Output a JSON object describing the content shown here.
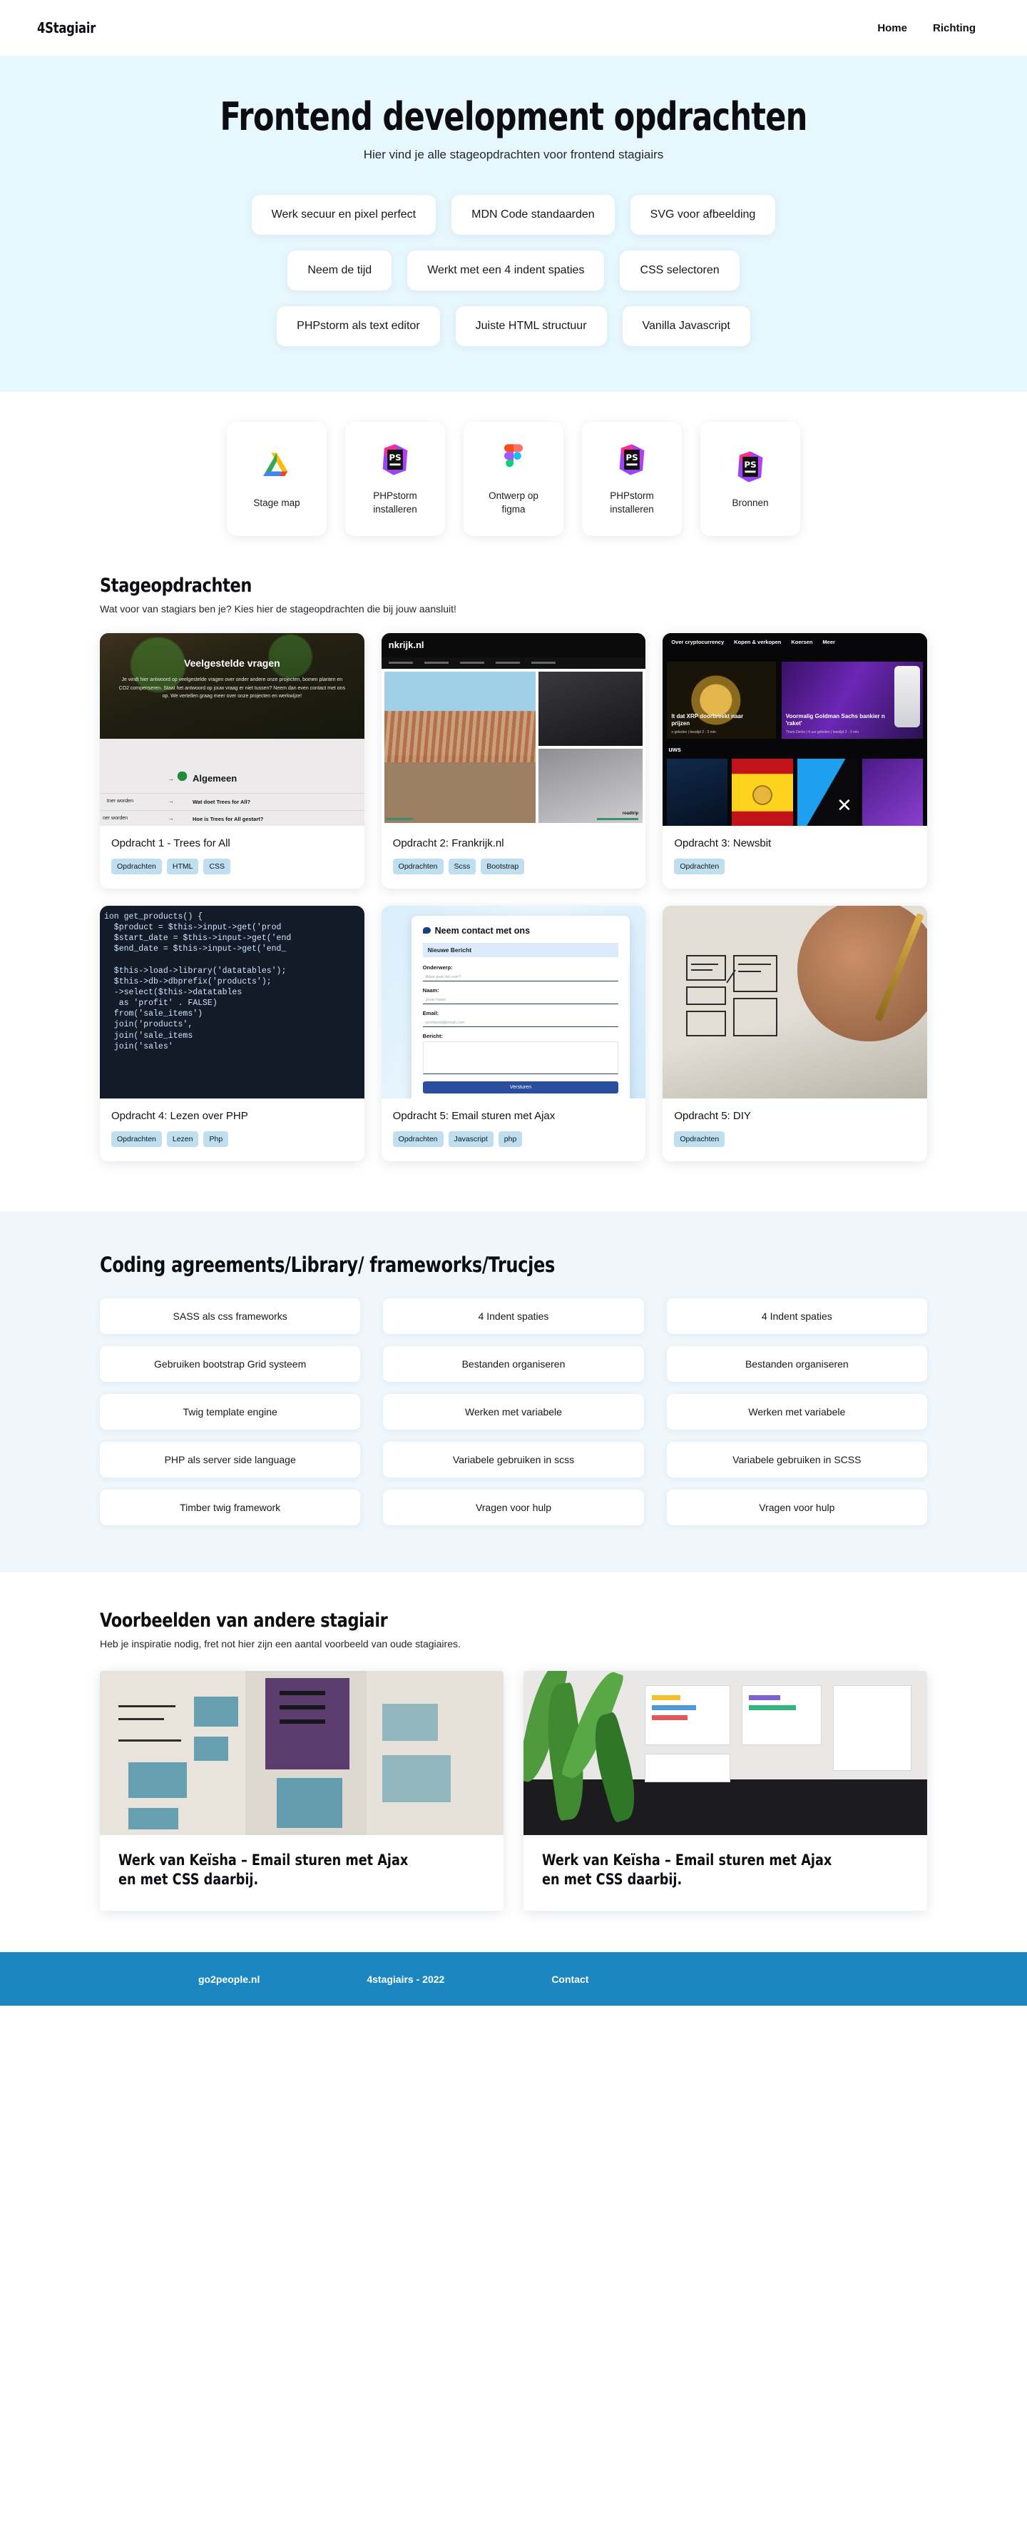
{
  "header": {
    "brand": "4Stagiair",
    "nav": [
      {
        "label": "Home"
      },
      {
        "label": "Richting"
      }
    ]
  },
  "hero": {
    "title": "Frontend development opdrachten",
    "subtitle": "Hier vind je alle stageopdrachten voor frontend stagiairs",
    "pill_rows": [
      [
        "Werk secuur en pixel perfect",
        "MDN Code standaarden",
        "SVG voor afbeelding"
      ],
      [
        "Neem de tijd",
        "Werkt met een 4 indent spaties",
        "CSS selectoren"
      ],
      [
        "PHPstorm als text editor",
        "Juiste HTML structuur",
        "Vanilla Javascript"
      ]
    ],
    "background": "#e6f7fd"
  },
  "tools": [
    {
      "icon": "google-drive-icon",
      "label": "Stage map"
    },
    {
      "icon": "phpstorm-icon",
      "label": "PHPstorm installeren"
    },
    {
      "icon": "figma-icon",
      "label": "Ontwerp op figma"
    },
    {
      "icon": "phpstorm-icon",
      "label": "PHPstorm installeren"
    },
    {
      "icon": "phpstorm-icon",
      "label": "Bronnen"
    }
  ],
  "opdrachten": {
    "title": "Stageopdrachten",
    "subtitle": "Wat voor van stagiars ben je? Kies hier de stageopdrachten die bij jouw aansluit!",
    "cards": [
      {
        "title": "Opdracht 1 - Trees for All",
        "tags": [
          "Opdrachten",
          "HTML",
          "CSS"
        ],
        "thumb": "trees-for-all-faq-screenshot",
        "thumb_text": {
          "heading": "Veelgestelde vragen",
          "paragraph": "Je vindt hier antwoord op veelgestelde vragen over onder andere onze projecten, bomen planten en CO2 compenseren. Staat het antwoord op jouw vraag er niet tussen? Neem dan even contact met ons op. We vertellen graag meer over onze projecten en werkwijze!",
          "category": "Algemeen",
          "q1": "Wat doet Trees for All?",
          "q2": "Hoe is Trees for All gestart?",
          "side1": "tner worden",
          "side2": "ner worden"
        }
      },
      {
        "title": "Opdracht 2: Frankrijk.nl",
        "tags": [
          "Opdrachten",
          "Scss",
          "Bootstrap"
        ],
        "thumb": "frankrijk-nl-screenshot",
        "thumb_text": {
          "brand": "nkrijk.nl",
          "caption": "roadtrip"
        }
      },
      {
        "title": "Opdracht 3: Newsbit",
        "tags": [
          "Opdrachten"
        ],
        "thumb": "newsbit-crypto-screenshot",
        "thumb_text": {
          "nav": [
            "Over cryptocurrency",
            "Kopen & verkopen",
            "Koersen",
            "Meer"
          ],
          "feature1": "lt dat XRP doorbreekt naar prijzen",
          "feature2": "Voormalig Goldman Sachs bankier n 'raket'",
          "meta1": "o geleden  |  leestijd 2 - 3 min",
          "meta2": "Thom Derks  |  4 uur geleden  |  leestijd 2 - 3 min",
          "section": "uws"
        }
      },
      {
        "title": "Opdracht 4: Lezen over PHP",
        "tags": [
          "Opdrachten",
          "Lezen",
          "Php"
        ],
        "thumb": "php-code-screenshot",
        "code": "ion get_products() {\n  $product = $this->input->get('prod\n  $start_date = $this->input->get('end\n  $end_date = $this->input->get('end_\n\n  $this->load->library('datatables');\n  $this->db->dbprefix('products');\n  ->select($this->datatables\n   as 'profit' . FALSE)\n  from('sale_items')\n  join('products',\n  join('sale_items\n  join('sales'"
      },
      {
        "title": "Opdracht 5: Email sturen met Ajax",
        "tags": [
          "Opdrachten",
          "Javascript",
          "php"
        ],
        "thumb": "contact-form-screenshot",
        "thumb_text": {
          "heading": "Neem contact met ons",
          "badge": "Nieuwe Bericht",
          "label1": "Onderwerp:",
          "ph1": "Waar gaat het over?",
          "label2": "Naam:",
          "ph2": "Jouw naam",
          "label3": "Email:",
          "ph3": "voorbeeld@email.com",
          "label4": "Bericht:",
          "button": "Versturen"
        }
      },
      {
        "title": "Opdracht 5: DIY",
        "tags": [
          "Opdrachten"
        ],
        "thumb": "hand-drawing-wireframe-photo"
      }
    ]
  },
  "coding": {
    "title": "Coding agreements/Library/ frameworks/Trucjes",
    "columns": [
      [
        "SASS als css frameworks",
        "Gebruiken bootstrap Grid systeem",
        "Twig template engine",
        "PHP als server side language",
        "Timber twig framework"
      ],
      [
        "4 Indent spaties",
        "Bestanden organiseren",
        "Werken met variabele",
        "Variabele gebruiken in scss",
        "Vragen voor hulp"
      ],
      [
        "4 Indent spaties",
        "Bestanden organiseren",
        "Werken met variabele",
        "Variabele gebruiken in SCSS",
        "Vragen voor hulp"
      ]
    ],
    "background": "#eff7fd"
  },
  "voorbeelden": {
    "title": "Voorbeelden van andere stagiair",
    "subtitle": "Heb je inspiratie  nodig, fret not  hier zijn een aantal voorbeeld van oude stagiaires.",
    "cards": [
      {
        "title": "Werk van Keïsha – Email sturen met Ajax en met CSS daarbij.",
        "thumb": "wireframe-sketch-photo"
      },
      {
        "title": "Werk van Keïsha – Email sturen met Ajax en met CSS daarbij.",
        "thumb": "plant-desk-ui-kit-photo"
      }
    ]
  },
  "footer": {
    "background": "#1b86c0",
    "links": [
      {
        "label": "go2people.nl"
      },
      {
        "label": "4stagiairs - 2022"
      },
      {
        "label": "Contact"
      }
    ]
  }
}
